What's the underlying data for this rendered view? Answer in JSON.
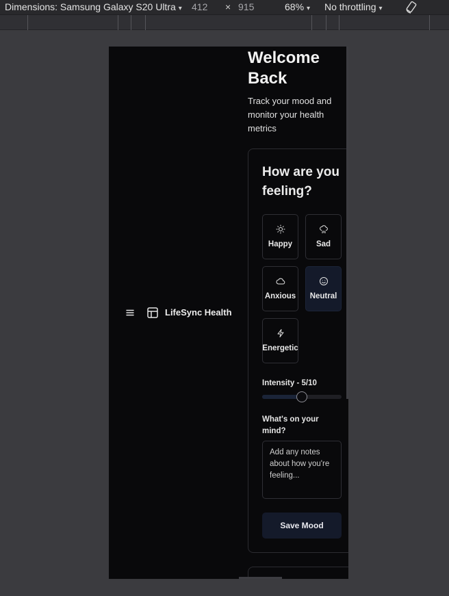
{
  "devtools": {
    "dimensions_label": "Dimensions: Samsung Galaxy S20 Ultra",
    "width": "412",
    "times": "×",
    "height": "915",
    "zoom": "68%",
    "throttling": "No throttling",
    "caret": "▾"
  },
  "header": {
    "brand_name": "LifeSync Health",
    "menu_icon": "menu-icon",
    "brand_icon": "layout-panel-icon"
  },
  "main": {
    "title": "Welcome Back",
    "subtitle": "Track your mood and monitor your health metrics"
  },
  "mood_card": {
    "title": "How are you feeling?",
    "moods": [
      {
        "label": "Happy",
        "icon": "sun-icon",
        "selected": false
      },
      {
        "label": "Sad",
        "icon": "cloud-rain-icon",
        "selected": false
      },
      {
        "label": "Anxious",
        "icon": "cloud-icon",
        "selected": false
      },
      {
        "label": "Neutral",
        "icon": "smile-icon",
        "selected": true
      },
      {
        "label": "Energetic",
        "icon": "zap-icon",
        "selected": false
      }
    ],
    "intensity_label": "Intensity - 5/10",
    "intensity_value": 5,
    "intensity_max": 10,
    "notes_label": "What's on your mind?",
    "notes_placeholder": "Add any notes about how you're feeling...",
    "save_label": "Save Mood"
  },
  "colors": {
    "background": "#09090b",
    "selected": "#141a2a",
    "border": "#2c2c31"
  }
}
